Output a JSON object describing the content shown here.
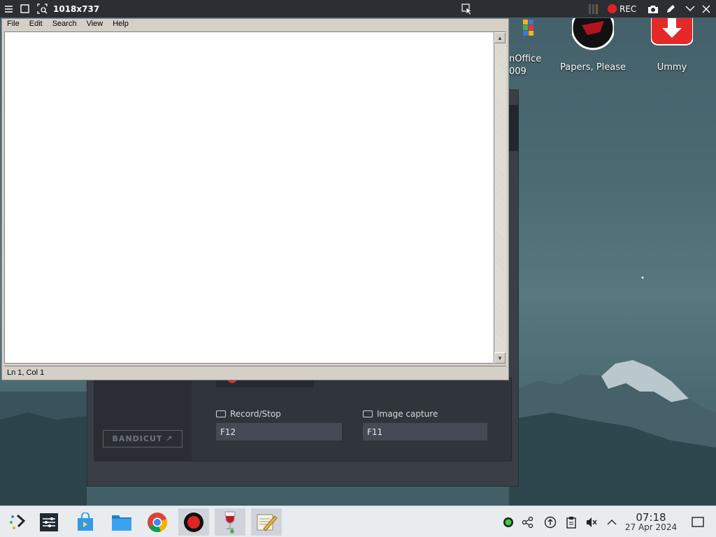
{
  "topbar": {
    "resolution": "1018x737",
    "rec_label": "REC"
  },
  "desktop": {
    "icons": [
      {
        "label": "nOffice",
        "label2": "009"
      },
      {
        "label": "Papers, Please"
      },
      {
        "label": "Ummy"
      }
    ]
  },
  "bandicam": {
    "bandicut_label": "BANDICUT ↗",
    "record_stop_label": "Record/Stop",
    "record_stop_key": "F12",
    "image_capture_label": "Image capture",
    "image_capture_key": "F11"
  },
  "notepad": {
    "menu": [
      "File",
      "Edit",
      "Search",
      "View",
      "Help"
    ],
    "status": "Ln 1, Col 1"
  },
  "taskbar": {
    "time": "07:18",
    "date": "27 Apr 2024"
  },
  "colors": {
    "rec_red": "#e02424",
    "taskbar_bg": "#e9ecef",
    "notepad_chrome": "#d4d0c8"
  }
}
